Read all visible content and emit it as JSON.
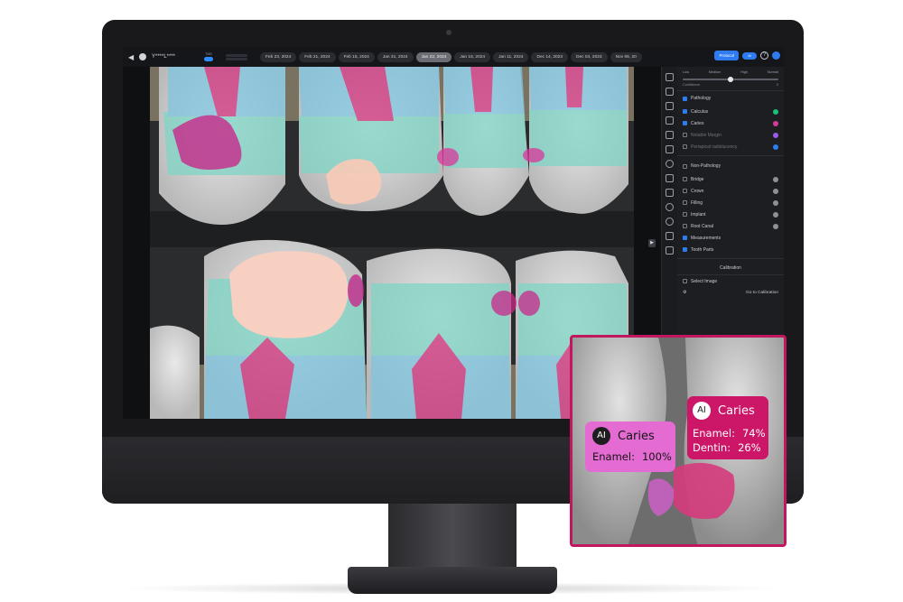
{
  "topbar": {
    "patient_name": "Y****L****",
    "tmb_label": "TMB",
    "dates": [
      "Feb 23, 2024",
      "Feb 21, 2024",
      "Feb 15, 2024",
      "Jan 31, 2024",
      "Jan 22, 2024",
      "Jan 18, 2024",
      "Jan 11, 2024",
      "Dec 14, 2023",
      "Dec 04, 2023",
      "Nov 06, 20"
    ],
    "active_date_index": 4,
    "protocol_label": "Protocol",
    "toggle_label": "AI",
    "help_label": "?"
  },
  "panel": {
    "slider": {
      "labels": [
        "Low",
        "Medium",
        "High",
        "Normal"
      ],
      "confidence_label": "Confidence",
      "confidence_value": "0",
      "level": 0.5
    },
    "pathology": {
      "title": "Pathology",
      "items": [
        {
          "label": "Calculus",
          "checked": true,
          "color": "#19c27a"
        },
        {
          "label": "Caries",
          "checked": true,
          "color": "#d43c9a"
        },
        {
          "label": "Notable Margin",
          "checked": false,
          "color": "#9b59f0"
        },
        {
          "label": "Periapical radiolucency",
          "checked": false,
          "color": "#2f7cf2"
        }
      ]
    },
    "non_pathology": {
      "title": "Non-Pathology",
      "items": [
        {
          "label": "Bridge",
          "checked": false
        },
        {
          "label": "Crown",
          "checked": false
        },
        {
          "label": "Filling",
          "checked": false
        },
        {
          "label": "Implant",
          "checked": false
        },
        {
          "label": "Root Canal",
          "checked": false
        }
      ]
    },
    "measurements": {
      "label": "Measurements",
      "checked": true
    },
    "tooth_parts": {
      "label": "Tooth Parts",
      "checked": true
    },
    "calibration": {
      "title": "Calibration",
      "select_image": "Select Image",
      "link": "Go to Calibration"
    }
  },
  "inset": {
    "tip_a": {
      "badge": "AI",
      "title": "Caries",
      "lines": [
        {
          "k": "Enamel:",
          "v": "100%"
        }
      ]
    },
    "tip_b": {
      "badge": "AI",
      "title": "Caries",
      "lines": [
        {
          "k": "Enamel:",
          "v": "74%"
        },
        {
          "k": "Dentin:",
          "v": "26%"
        }
      ]
    }
  }
}
